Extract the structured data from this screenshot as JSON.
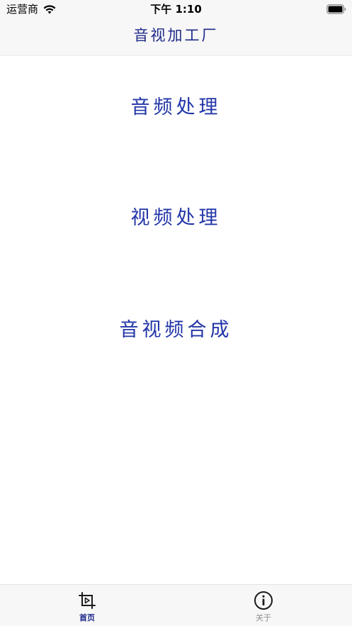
{
  "status_bar": {
    "carrier": "运营商",
    "time": "下午 1:10"
  },
  "nav": {
    "title": "音视加工厂"
  },
  "menu": {
    "items": [
      {
        "label": "音频处理"
      },
      {
        "label": "视频处理"
      },
      {
        "label": "音视频合成"
      }
    ]
  },
  "tab_bar": {
    "tabs": [
      {
        "label": "首页",
        "icon": "crop-play-icon",
        "selected": true,
        "color": "#1e2a8a"
      },
      {
        "label": "关于",
        "icon": "info-circle-icon",
        "selected": false,
        "color": "#8e8e93"
      }
    ]
  },
  "colors": {
    "accent": "#2336a8",
    "title": "#1e2a8a",
    "bar_background": "#f7f7f7"
  }
}
